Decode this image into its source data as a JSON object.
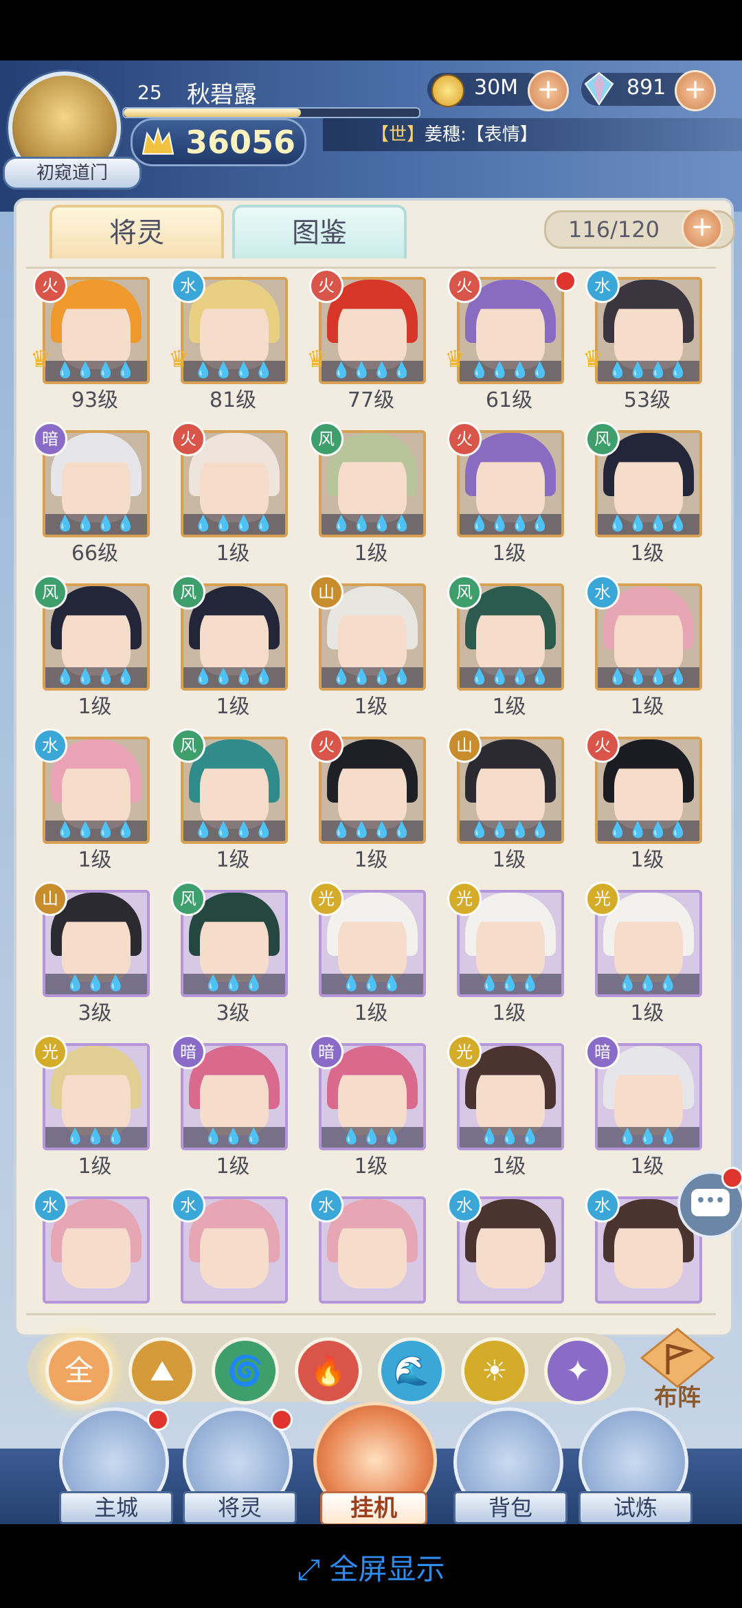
{
  "player": {
    "level": "25",
    "name": "秋碧露",
    "rank": "初窥道门",
    "power": "36056",
    "xp_fraction": 0.6
  },
  "currency": {
    "gold": "30M",
    "gems": "891"
  },
  "chat": {
    "channel": "【世】",
    "message": "姜穗:【表情】"
  },
  "tabs": [
    "将灵",
    "图鉴"
  ],
  "capacity": "116/120",
  "elements": {
    "fire": {
      "glyph": "火",
      "color": "#d9554a"
    },
    "water": {
      "glyph": "水",
      "color": "#3aa7d8"
    },
    "wind": {
      "glyph": "风",
      "color": "#3e9e6c"
    },
    "earth": {
      "glyph": "山",
      "color": "#c98c2c"
    },
    "light": {
      "glyph": "光",
      "color": "#d4ac2a"
    },
    "dark": {
      "glyph": "暗",
      "color": "#8a6cc8"
    }
  },
  "spirits": [
    {
      "level": "93级",
      "element": "fire",
      "frame": "gold",
      "crown": true,
      "dot": false,
      "hair": "#f09a2e",
      "stars": "💧💧💧💧"
    },
    {
      "level": "81级",
      "element": "water",
      "frame": "gold",
      "crown": true,
      "dot": false,
      "hair": "#e8cf82",
      "stars": "💧💧💧💧"
    },
    {
      "level": "77级",
      "element": "fire",
      "frame": "gold",
      "crown": true,
      "dot": false,
      "hair": "#d83628",
      "stars": "💧💧💧💧"
    },
    {
      "level": "61级",
      "element": "fire",
      "frame": "gold",
      "crown": true,
      "dot": true,
      "hair": "#8a6bc2",
      "stars": "💧💧💧💧"
    },
    {
      "level": "53级",
      "element": "water",
      "frame": "gold",
      "crown": true,
      "dot": false,
      "hair": "#3b3540",
      "stars": "💧💧💧💧"
    },
    {
      "level": "66级",
      "element": "dark",
      "frame": "gold",
      "crown": false,
      "dot": false,
      "hair": "#e6e6ea",
      "stars": "💧💧💧💧"
    },
    {
      "level": "1级",
      "element": "fire",
      "frame": "gold",
      "crown": false,
      "dot": false,
      "hair": "#efe4dc",
      "stars": "💧💧💧💧"
    },
    {
      "level": "1级",
      "element": "wind",
      "frame": "gold",
      "crown": false,
      "dot": false,
      "hair": "#b8c49a",
      "stars": "💧💧💧💧"
    },
    {
      "level": "1级",
      "element": "fire",
      "frame": "gold",
      "crown": false,
      "dot": false,
      "hair": "#8a6bc2",
      "stars": "💧💧💧💧"
    },
    {
      "level": "1级",
      "element": "wind",
      "frame": "gold",
      "crown": false,
      "dot": false,
      "hair": "#232638",
      "stars": "💧💧💧💧"
    },
    {
      "level": "1级",
      "element": "wind",
      "frame": "gold",
      "crown": false,
      "dot": false,
      "hair": "#232638",
      "stars": "💧💧💧💧"
    },
    {
      "level": "1级",
      "element": "wind",
      "frame": "gold",
      "crown": false,
      "dot": false,
      "hair": "#232638",
      "stars": "💧💧💧💧"
    },
    {
      "level": "1级",
      "element": "earth",
      "frame": "gold",
      "crown": false,
      "dot": false,
      "hair": "#e8e6e0",
      "stars": "💧💧💧💧"
    },
    {
      "level": "1级",
      "element": "wind",
      "frame": "gold",
      "crown": false,
      "dot": false,
      "hair": "#2c5a4c",
      "stars": "💧💧💧💧"
    },
    {
      "level": "1级",
      "element": "water",
      "frame": "gold",
      "crown": false,
      "dot": false,
      "hair": "#e7a6b4",
      "stars": "💧💧💧💧"
    },
    {
      "level": "1级",
      "element": "water",
      "frame": "gold",
      "crown": false,
      "dot": false,
      "hair": "#eaa3b6",
      "stars": "💧💧💧💧"
    },
    {
      "level": "1级",
      "element": "wind",
      "frame": "gold",
      "crown": false,
      "dot": false,
      "hair": "#2f8c8a",
      "stars": "💧💧💧💧"
    },
    {
      "level": "1级",
      "element": "fire",
      "frame": "gold",
      "crown": false,
      "dot": false,
      "hair": "#1f1f26",
      "stars": "💧💧💧💧"
    },
    {
      "level": "1级",
      "element": "earth",
      "frame": "gold",
      "crown": false,
      "dot": false,
      "hair": "#2a2a30",
      "stars": "💧💧💧💧"
    },
    {
      "level": "1级",
      "element": "fire",
      "frame": "gold",
      "crown": false,
      "dot": false,
      "hair": "#1b1b22",
      "stars": "💧💧💧💧"
    },
    {
      "level": "3级",
      "element": "earth",
      "frame": "purple",
      "crown": false,
      "dot": false,
      "hair": "#2a2a30",
      "stars": "💧💧💧"
    },
    {
      "level": "3级",
      "element": "wind",
      "frame": "purple",
      "crown": false,
      "dot": false,
      "hair": "#24473f",
      "stars": "💧💧💧"
    },
    {
      "level": "1级",
      "element": "light",
      "frame": "purple",
      "crown": false,
      "dot": false,
      "hair": "#f3f1ee",
      "stars": "💧💧💧"
    },
    {
      "level": "1级",
      "element": "light",
      "frame": "purple",
      "crown": false,
      "dot": false,
      "hair": "#f3f1ee",
      "stars": "💧💧💧"
    },
    {
      "level": "1级",
      "element": "light",
      "frame": "purple",
      "crown": false,
      "dot": false,
      "hair": "#f3f1ee",
      "stars": "💧💧💧"
    },
    {
      "level": "1级",
      "element": "light",
      "frame": "purple",
      "crown": false,
      "dot": false,
      "hair": "#e2cf93",
      "stars": "💧💧💧"
    },
    {
      "level": "1级",
      "element": "dark",
      "frame": "purple",
      "crown": false,
      "dot": false,
      "hair": "#d96a8e",
      "stars": "💧💧💧"
    },
    {
      "level": "1级",
      "element": "dark",
      "frame": "purple",
      "crown": false,
      "dot": false,
      "hair": "#d96a8e",
      "stars": "💧💧💧"
    },
    {
      "level": "1级",
      "element": "light",
      "frame": "purple",
      "crown": false,
      "dot": false,
      "hair": "#4b3430",
      "stars": "💧💧💧"
    },
    {
      "level": "1级",
      "element": "dark",
      "frame": "purple",
      "crown": false,
      "dot": false,
      "hair": "#e6e6ea",
      "stars": "💧💧💧"
    },
    {
      "level": "",
      "element": "water",
      "frame": "purple",
      "crown": false,
      "dot": false,
      "hair": "#e7a6b4",
      "stars": ""
    },
    {
      "level": "",
      "element": "water",
      "frame": "purple",
      "crown": false,
      "dot": false,
      "hair": "#e7a6b4",
      "stars": ""
    },
    {
      "level": "",
      "element": "water",
      "frame": "purple",
      "crown": false,
      "dot": false,
      "hair": "#e7a6b4",
      "stars": ""
    },
    {
      "level": "",
      "element": "water",
      "frame": "purple",
      "crown": false,
      "dot": false,
      "hair": "#4b3430",
      "stars": ""
    },
    {
      "level": "",
      "element": "water",
      "frame": "purple",
      "crown": false,
      "dot": false,
      "hair": "#4b3430",
      "stars": ""
    }
  ],
  "filters": [
    {
      "key": "all",
      "glyph": "全",
      "color": "#f0a560",
      "active": true
    },
    {
      "key": "earth",
      "glyph": "⛰",
      "color": "#d59a3a",
      "active": false
    },
    {
      "key": "wind",
      "glyph": "🌀",
      "color": "#3e9e6c",
      "active": false
    },
    {
      "key": "fire",
      "glyph": "🔥",
      "color": "#d9554a",
      "active": false
    },
    {
      "key": "water",
      "glyph": "🌊",
      "color": "#3aa7d8",
      "active": false
    },
    {
      "key": "light",
      "glyph": "☀",
      "color": "#d4ac2a",
      "active": false
    },
    {
      "key": "dark",
      "glyph": "✦",
      "color": "#8a6cc8",
      "active": false
    }
  ],
  "formation_label": "布阵",
  "nav": {
    "city": "主城",
    "spirits": "将灵",
    "idle": "挂机",
    "bag": "背包",
    "trial": "试炼"
  },
  "fullscreen_label": "全屏显示"
}
